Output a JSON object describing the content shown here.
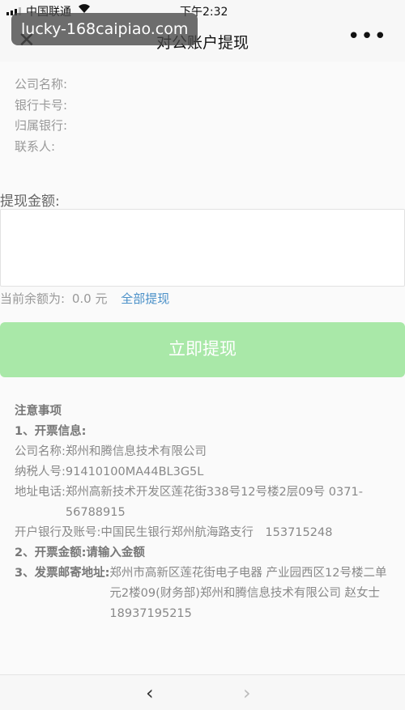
{
  "status_bar": {
    "carrier": "中国联通",
    "wifi_icon": "wifi-icon",
    "time": "下午2:32"
  },
  "watermark": {
    "text": "lucky-168caipiao.com"
  },
  "nav": {
    "title": "对公账户提现",
    "close_glyph": "✕",
    "more_glyph": "•••"
  },
  "info": {
    "company_label": "公司名称:",
    "card_label": "银行卡号:",
    "bank_label": "归属银行:",
    "contact_label": "联系人:"
  },
  "withdraw": {
    "amount_label": "提现金额:",
    "amount_value": "",
    "balance_label": "当前余额为:",
    "balance_value": "0.0",
    "balance_unit": "元",
    "withdraw_all": "全部提现",
    "submit": "立即提现"
  },
  "notes": {
    "title": "注意事项",
    "invoice_info": "1、开票信息:",
    "company_k": "公司名称:",
    "company_v": "郑州和腾信息技术有限公司",
    "tax_k": "纳税人号:",
    "tax_v": "91410100MA44BL3G5L",
    "addr_k": "地址电话:",
    "addr_v": "郑州高新技术开发区莲花街338号12号楼2层09号 0371-56788915",
    "bank_k": "开户银行及账号:",
    "bank_v": "中国民生银行郑州航海路支行　153715248",
    "amount_k": "2、开票金额:",
    "amount_v": "请输入金额",
    "mail_k": "3、发票邮寄地址:",
    "mail_v": "郑州市高新区莲花街电子电器 产业园西区12号楼二单元2楼09(财务部)郑州和腾信息技术有限公司 赵女士 18937195215"
  },
  "bottom": {
    "back_glyph": "‹",
    "forward_glyph": "›"
  },
  "colors": {
    "submit_bg": "#a9e8a8",
    "link": "#4a90c8"
  }
}
